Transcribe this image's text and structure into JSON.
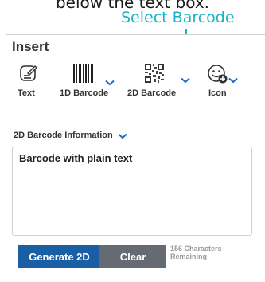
{
  "caption": {
    "text": "below the text box."
  },
  "annotation": {
    "text": "Select Barcode",
    "color": "#1ab3c6"
  },
  "panel": {
    "title": "Insert"
  },
  "toolbar": {
    "items": [
      {
        "label": "Text",
        "icon": "edit-text-icon"
      },
      {
        "label": "1D Barcode",
        "icon": "barcode-1d-icon"
      },
      {
        "label": "2D Barcode",
        "icon": "qr-code-icon"
      },
      {
        "label": "Icon",
        "icon": "emoji-add-icon"
      }
    ]
  },
  "section": {
    "label": "2D Barcode Information"
  },
  "input": {
    "value": "Barcode with plain text"
  },
  "actions": {
    "generate_label": "Generate 2D",
    "clear_label": "Clear",
    "chars_count": "156 Characters",
    "chars_suffix": "Remaining"
  },
  "colors": {
    "accent": "#1a5ea3",
    "chevron": "#1a6fc4",
    "clear": "#666a73"
  }
}
